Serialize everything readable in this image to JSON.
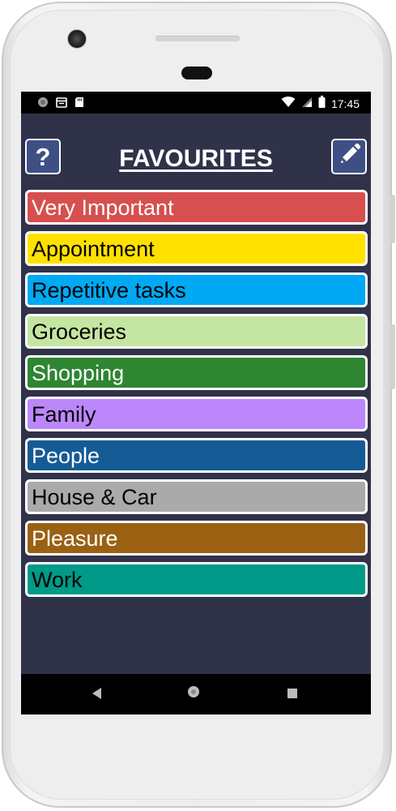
{
  "status_bar": {
    "time": "17:45",
    "left_icons": [
      "circle-notification-icon",
      "calendar-notification-icon",
      "sd-card-icon"
    ],
    "right_icons": [
      "wifi-icon",
      "cell-signal-icon",
      "battery-icon"
    ]
  },
  "header": {
    "title": "FAVOURITES",
    "help_label": "?",
    "help_icon": "question-mark-icon",
    "edit_icon": "pencil-icon"
  },
  "colors": {
    "screen_background": "#30324a",
    "header_button": "#3e4f86",
    "item_border": "#ffffff"
  },
  "favourites": [
    {
      "label": "Very Important",
      "color": "#d74f4f",
      "text_color": "#ffffff"
    },
    {
      "label": "Appointment",
      "color": "#ffe100",
      "text_color": "#000000"
    },
    {
      "label": "Repetitive tasks",
      "color": "#00a9f4",
      "text_color": "#000000"
    },
    {
      "label": "Groceries",
      "color": "#c5e5a3",
      "text_color": "#000000"
    },
    {
      "label": "Shopping",
      "color": "#2e8532",
      "text_color": "#ffffff"
    },
    {
      "label": "Family",
      "color": "#bb87fb",
      "text_color": "#000000"
    },
    {
      "label": "People",
      "color": "#155b96",
      "text_color": "#ffffff"
    },
    {
      "label": "House & Car",
      "color": "#aaaaaa",
      "text_color": "#000000"
    },
    {
      "label": "Pleasure",
      "color": "#9a6113",
      "text_color": "#ffffff"
    },
    {
      "label": "Work",
      "color": "#009a88",
      "text_color": "#000000"
    }
  ],
  "nav_bar": {
    "icons": [
      "back-icon",
      "home-icon",
      "recent-apps-icon"
    ]
  }
}
